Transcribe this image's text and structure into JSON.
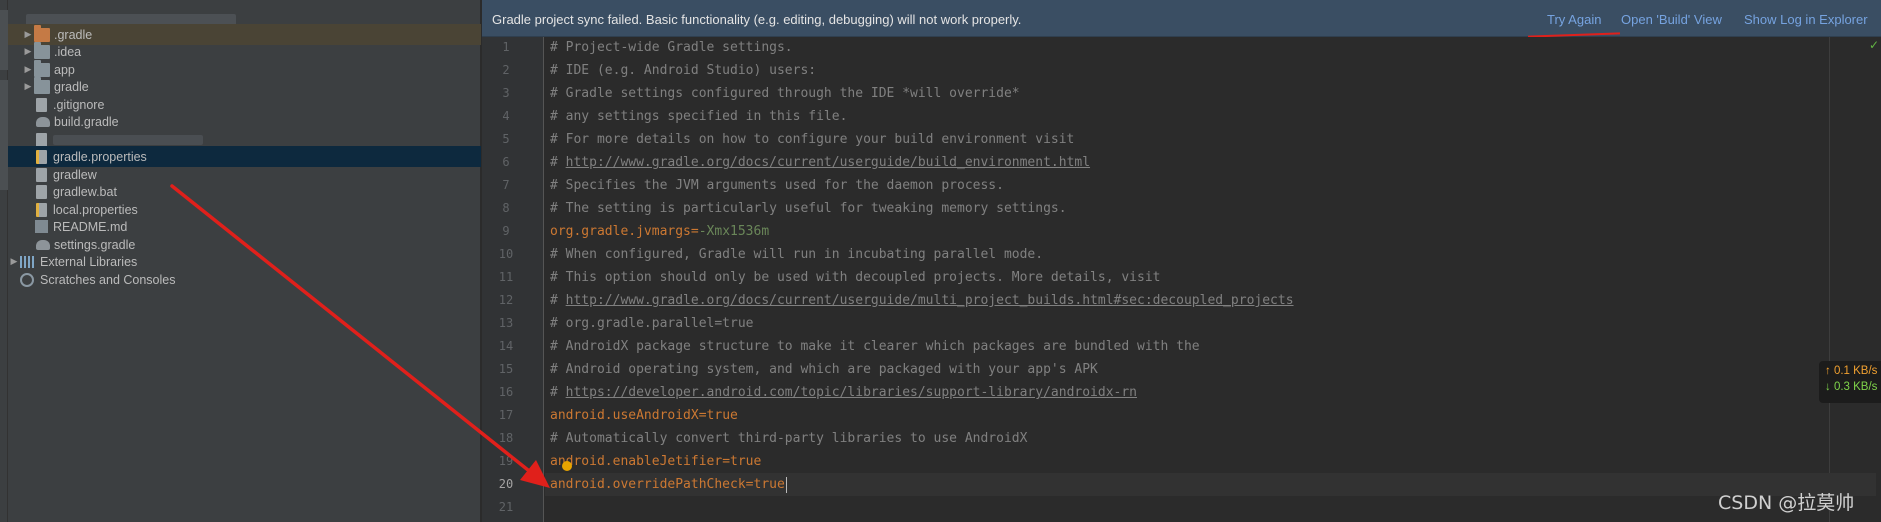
{
  "banner": {
    "message": "Gradle project sync failed. Basic functionality (e.g. editing, debugging) will not work properly.",
    "try_again": "Try Again",
    "open_build": "Open 'Build' View",
    "show_log": "Show Log in Explorer"
  },
  "project_tree": {
    "items": [
      {
        "label": ".gradle",
        "icon": "folder-icon"
      },
      {
        "label": ".idea",
        "icon": "folder-icon"
      },
      {
        "label": "app",
        "icon": "folder-icon"
      },
      {
        "label": "gradle",
        "icon": "folder-icon"
      },
      {
        "label": ".gitignore",
        "icon": "file-icon"
      },
      {
        "label": "build.gradle",
        "icon": "gradle-icon"
      },
      {
        "label": "gradle.properties",
        "icon": "properties-file-icon"
      },
      {
        "label": "gradlew",
        "icon": "file-icon"
      },
      {
        "label": "gradlew.bat",
        "icon": "file-icon"
      },
      {
        "label": "local.properties",
        "icon": "properties-file-icon"
      },
      {
        "label": "README.md",
        "icon": "markdown-icon"
      },
      {
        "label": "settings.gradle",
        "icon": "gradle-icon"
      },
      {
        "label": "External Libraries",
        "icon": "library-icon"
      },
      {
        "label": "Scratches and Consoles",
        "icon": "scratch-icon"
      }
    ]
  },
  "editor": {
    "lines": [
      "# Project-wide Gradle settings.",
      "# IDE (e.g. Android Studio) users:",
      "# Gradle settings configured through the IDE *will override*",
      "# any settings specified in this file.",
      "# For more details on how to configure your build environment visit",
      "http://www.gradle.org/docs/current/userguide/build_environment.html",
      "# Specifies the JVM arguments used for the daemon process.",
      "# The setting is particularly useful for tweaking memory settings.",
      "org.gradle.jvmargs",
      "# When configured, Gradle will run in incubating parallel mode.",
      "# This option should only be used with decoupled projects. More details, visit",
      "http://www.gradle.org/docs/current/userguide/multi_project_builds.html#sec:decoupled_projects",
      "# org.gradle.parallel=true",
      "# AndroidX package structure to make it clearer which packages are bundled with the",
      "# Android operating system, and which are packaged with your app's APK",
      "https://developer.android.com/topic/libraries/support-library/androidx-rn",
      "android.useAndroidX",
      "# Automatically convert third-party libraries to use AndroidX",
      "android.enableJetifier",
      "android.overridePathCheck",
      ""
    ],
    "values": {
      "jvmargs": "-Xmx1536m",
      "useAndroidX": "true",
      "enableJetifier": "true",
      "overridePathCheck": "true"
    },
    "comment_prefix": "# ",
    "equals": "=",
    "line_numbers": [
      "1",
      "2",
      "3",
      "4",
      "5",
      "6",
      "7",
      "8",
      "9",
      "10",
      "11",
      "12",
      "13",
      "14",
      "15",
      "16",
      "17",
      "18",
      "19",
      "20",
      "21"
    ]
  },
  "net_speed": {
    "up": "↑ 0.1 KB/s",
    "down": "↓ 0.3 KB/s"
  },
  "watermark": "CSDN @拉莫帅",
  "colors": {
    "banner_bg": "#3a4e63",
    "link": "#76a3e0",
    "annotation_red": "#e0201b",
    "key_orange": "#cc7832",
    "value_green": "#6a8759",
    "comment_gray": "#808080"
  }
}
